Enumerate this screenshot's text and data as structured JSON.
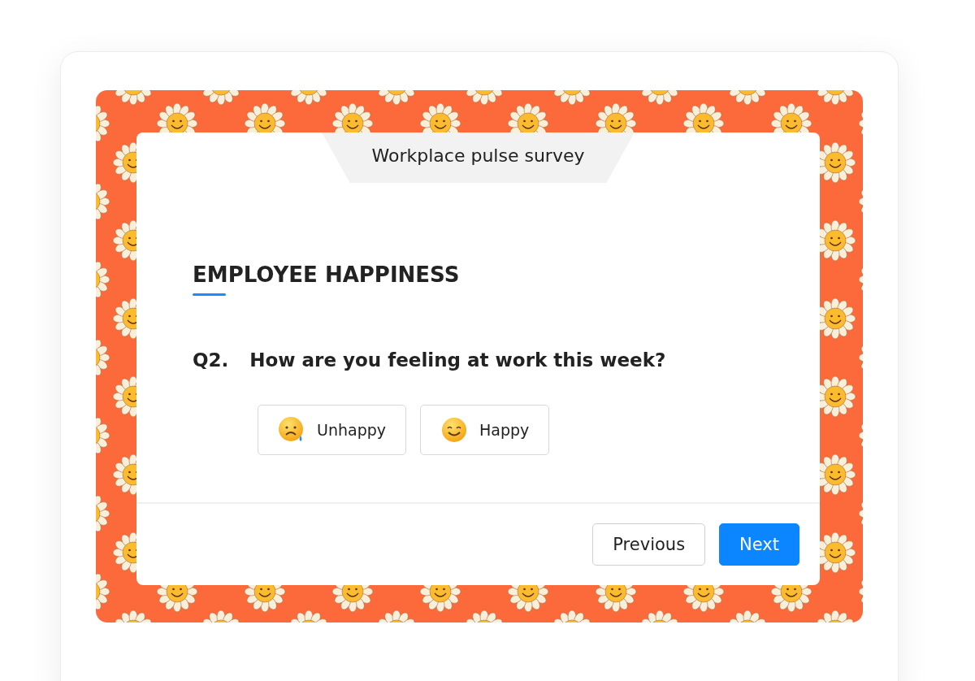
{
  "survey_title": "Workplace pulse survey",
  "section_heading": "EMPLOYEE HAPPINESS",
  "question": {
    "number": "Q2.",
    "text": "How are you feeling at work this week?"
  },
  "options": [
    {
      "kind": "sad",
      "label": "Unhappy"
    },
    {
      "kind": "happy",
      "label": "Happy"
    }
  ],
  "buttons": [
    {
      "kind": "secondary",
      "label": "Previous"
    },
    {
      "kind": "primary",
      "label": "Next"
    }
  ]
}
